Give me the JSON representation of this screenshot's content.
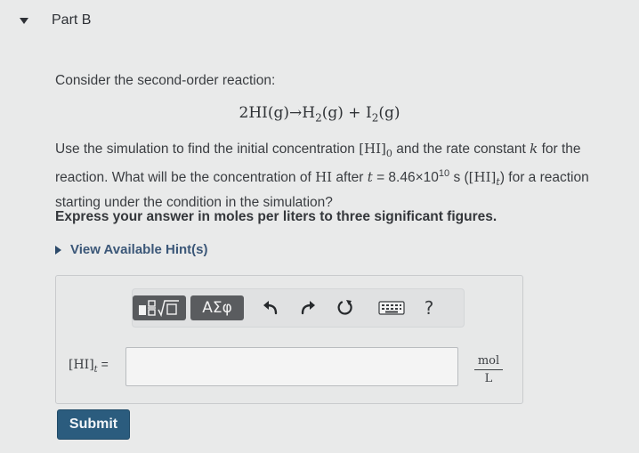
{
  "part": {
    "title": "Part B"
  },
  "problem": {
    "intro": "Consider the second-order reaction:",
    "equation": {
      "reactant_coef": "2",
      "reactant": "HI",
      "reactant_state": "(g)",
      "arrow": "→",
      "product1": "H",
      "product1_sub": "2",
      "product1_state": "(g)",
      "plus": " + ",
      "product2": "I",
      "product2_sub": "2",
      "product2_state": "(g)"
    },
    "question": {
      "t1": "Use the simulation to find the initial concentration ",
      "conc0": "[HI]",
      "conc0_sub": "0",
      "t2": " and the rate constant ",
      "k": "k",
      "t3": " for the reaction. What will be the concentration of ",
      "hi": "HI",
      "t4": " after ",
      "t": "t",
      "t5": " = 8.46×10",
      "exponent": "10",
      "t6": " s (",
      "conct": "[HI]",
      "conct_sub": "t",
      "t7": ") for a reaction starting under the condition in the simulation?"
    },
    "instruction": "Express your answer in moles per liters to three significant figures."
  },
  "hint": {
    "label": "View Available Hint(s)"
  },
  "toolbar": {
    "greek_label": "ΑΣφ",
    "help_label": "?"
  },
  "answer": {
    "var_main": "[HI]",
    "var_sub": "t",
    "equals": " =",
    "value": "",
    "unit_num": "mol",
    "unit_den": "L"
  },
  "submit": {
    "label": "Submit"
  },
  "colors": {
    "submit_bg": "#2b5c7e",
    "hint_link": "#3b5778",
    "toolbar_button": "#5a5c5f"
  }
}
